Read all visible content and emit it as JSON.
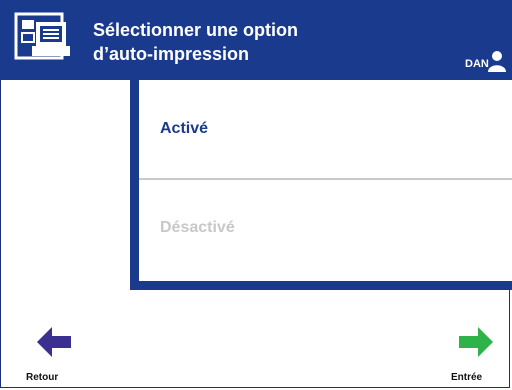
{
  "header": {
    "title_line1": "Sélectionner une option",
    "title_line2": "d’auto-impression",
    "icon": "print-settings-icon",
    "user": {
      "label": "DAN",
      "icon": "user-icon"
    }
  },
  "options": {
    "active_label": "Activé",
    "inactive_label": "Désactivé",
    "selected": "Activé"
  },
  "nav": {
    "back_label": "Retour",
    "back_icon": "arrow-left-icon",
    "enter_label": "Entrée",
    "enter_icon": "arrow-right-icon"
  },
  "colors": {
    "header_bg": "#1a3a8d",
    "back_arrow": "#3b2f8f",
    "enter_arrow": "#2db34a",
    "disabled_text": "#c8c8c8"
  }
}
